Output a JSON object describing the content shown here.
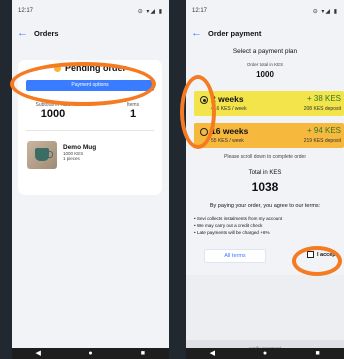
{
  "left": {
    "status_time": "12:17",
    "status_icons": "⊝ ▾◢ ▮",
    "title": "Orders",
    "status": "Pending order",
    "payment_button": "Payment options",
    "subtotal_label": "Subtotal in KES",
    "subtotal_value": "1000",
    "items_label": "Items",
    "items_value": "1",
    "product": {
      "name": "Demo Mug",
      "price": "1000 KES",
      "qty": "1 pieces"
    }
  },
  "right": {
    "status_time": "12:17",
    "status_icons": "⊝ ▾◢ ▮",
    "title": "Order payment",
    "select_label": "Select a payment plan",
    "order_total_label": "Order total in KES",
    "order_total_value": "1000",
    "plans": [
      {
        "weeks": "2 weeks",
        "per_week": "416 KES / week",
        "extra": "+ 38 KES",
        "deposit": "208 KES deposit",
        "color": "#f2e44a",
        "selected": true
      },
      {
        "weeks": "16 weeks",
        "per_week": "55 KES / week",
        "extra": "+ 94 KES",
        "deposit": "219 KES deposit",
        "color": "#f7b83e",
        "selected": false
      }
    ],
    "scroll_note": "Please scroll down to complete order",
    "total_label": "Total in KES",
    "total_value": "1038",
    "terms_head": "By paying your order, you agree to our terms:",
    "terms": [
      "Sevi collects instalments from my account",
      "We may carry out a credit check",
      "Late payments will be charged +6%"
    ],
    "all_terms": "All terms",
    "accept": "I accept",
    "verify": "verify payment"
  },
  "colors": {
    "accent": "#3a7cff",
    "annotation": "#f47b22",
    "yellow": "#f2e44a",
    "orange": "#f7b83e",
    "green": "#2d7a2d"
  }
}
